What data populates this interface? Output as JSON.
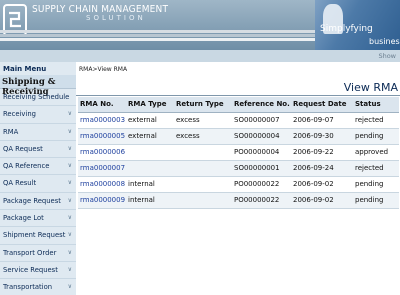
{
  "header": {
    "brand_title": "SUPPLY CHAIN MANAGEMENT",
    "brand_subtitle": "SOLUTION",
    "tagline_line1": "Simplyfying",
    "tagline_line2": "business",
    "show_link": "Show"
  },
  "sidebar": {
    "menu_title": "Main Menu",
    "section_title": "Shipping & Receiving",
    "items": [
      {
        "label": "Receiving Schedule",
        "has_arrow": false
      },
      {
        "label": "Receiving",
        "has_arrow": true
      },
      {
        "label": "RMA",
        "has_arrow": true
      },
      {
        "label": "QA Request",
        "has_arrow": true
      },
      {
        "label": "QA Reference",
        "has_arrow": true
      },
      {
        "label": "QA Result",
        "has_arrow": true
      },
      {
        "label": "Package Request",
        "has_arrow": true
      },
      {
        "label": "Package Lot",
        "has_arrow": true
      },
      {
        "label": "Shipment Request",
        "has_arrow": true
      },
      {
        "label": "Transport Order",
        "has_arrow": true
      },
      {
        "label": "Service Request",
        "has_arrow": true
      },
      {
        "label": "Transportation",
        "has_arrow": true
      }
    ],
    "arrow_icon": "chevron-down-icon"
  },
  "main": {
    "breadcrumb": "RMA>View RMA",
    "page_title": "View RMA",
    "columns": [
      "RMA No.",
      "RMA Type",
      "Return Type",
      "Reference No.",
      "Request Date",
      "Status"
    ],
    "rows": [
      [
        "rma0000003",
        "external",
        "excess",
        "SO00000007",
        "2006-09-07",
        "rejected"
      ],
      [
        "rma0000005",
        "external",
        "excess",
        "SO00000004",
        "2006-09-30",
        "pending"
      ],
      [
        "rma0000006",
        "",
        "",
        "PO00000004",
        "2006-09-22",
        "approved"
      ],
      [
        "rma0000007",
        "",
        "",
        "SO00000001",
        "2006-09-24",
        "rejected"
      ],
      [
        "rma0000008",
        "internal",
        "",
        "PO00000022",
        "2006-09-02",
        "pending"
      ],
      [
        "rma0000009",
        "internal",
        "",
        "PO00000022",
        "2006-09-02",
        "pending"
      ]
    ]
  },
  "colors": {
    "link": "#1d3f9e",
    "nav_text": "#0b2a55",
    "header_blue": "#6f8ea6"
  }
}
